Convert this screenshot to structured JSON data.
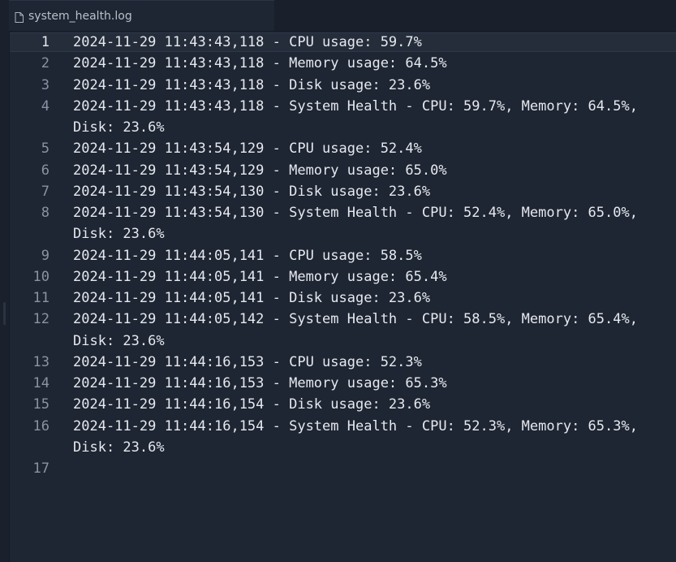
{
  "tab": {
    "title": "system_health.log",
    "icon": "file-icon"
  },
  "active_line": 1,
  "lines": [
    "2024-11-29 11:43:43,118 - CPU usage: 59.7%",
    "2024-11-29 11:43:43,118 - Memory usage: 64.5%",
    "2024-11-29 11:43:43,118 - Disk usage: 23.6%",
    "2024-11-29 11:43:43,118 - System Health - CPU: 59.7%, Memory: 64.5%, Disk: 23.6%",
    "2024-11-29 11:43:54,129 - CPU usage: 52.4%",
    "2024-11-29 11:43:54,129 - Memory usage: 65.0%",
    "2024-11-29 11:43:54,130 - Disk usage: 23.6%",
    "2024-11-29 11:43:54,130 - System Health - CPU: 52.4%, Memory: 65.0%, Disk: 23.6%",
    "2024-11-29 11:44:05,141 - CPU usage: 58.5%",
    "2024-11-29 11:44:05,141 - Memory usage: 65.4%",
    "2024-11-29 11:44:05,141 - Disk usage: 23.6%",
    "2024-11-29 11:44:05,142 - System Health - CPU: 58.5%, Memory: 65.4%, Disk: 23.6%",
    "2024-11-29 11:44:16,153 - CPU usage: 52.3%",
    "2024-11-29 11:44:16,153 - Memory usage: 65.3%",
    "2024-11-29 11:44:16,154 - Disk usage: 23.6%",
    "2024-11-29 11:44:16,154 - System Health - CPU: 52.3%, Memory: 65.3%, Disk: 23.6%",
    ""
  ],
  "line_numbers": [
    "1",
    "2",
    "3",
    "4",
    "5",
    "6",
    "7",
    "8",
    "9",
    "10",
    "11",
    "12",
    "13",
    "14",
    "15",
    "16",
    "17"
  ]
}
